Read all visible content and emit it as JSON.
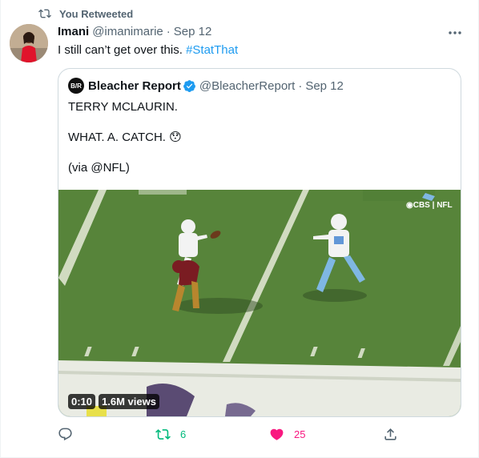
{
  "retweet_context": {
    "label": "You Retweeted",
    "icon": "retweet-icon"
  },
  "tweet": {
    "author_name": "Imani",
    "handle": "@imanimarie",
    "separator": "·",
    "date": "Sep 12",
    "text": "I still can’t get over this. ",
    "hashtag": "#StatThat"
  },
  "quoted_tweet": {
    "avatar_text": "B/R",
    "author_name": "Bleacher Report",
    "handle": "@BleacherReport",
    "separator": "·",
    "date": "Sep 12",
    "line1": "TERRY MCLAURIN.",
    "line2": "WHAT. A. CATCH. 😯",
    "line3": "(via @NFL)",
    "video": {
      "duration": "0:10",
      "views": "1.6M views",
      "watermark": "◉CBS | NFL"
    }
  },
  "actions": {
    "reply_count": "",
    "retweet_count": "6",
    "like_count": "25"
  },
  "colors": {
    "accent": "#1d9bf0",
    "retweet_green": "#00ba7c",
    "like_pink": "#f91880",
    "muted": "#536471"
  }
}
